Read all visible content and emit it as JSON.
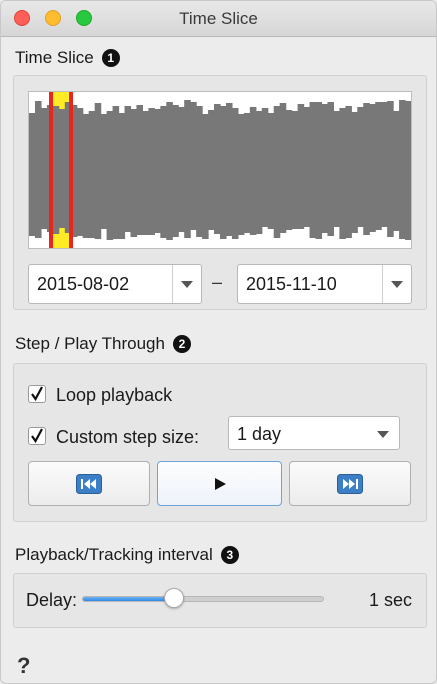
{
  "window": {
    "title": "Time Slice"
  },
  "time_slice": {
    "heading": "Time Slice",
    "badge": "1",
    "start_date": "2015-08-02",
    "separator": "–",
    "end_date": "2015-11-10"
  },
  "step": {
    "heading": "Step / Play Through",
    "badge": "2",
    "loop_label": "Loop playback",
    "loop_checked": true,
    "custom_label": "Custom step size:",
    "custom_checked": true,
    "step_size": "1 day",
    "buttons": [
      "skip-back-icon",
      "play-icon",
      "skip-forward-icon"
    ]
  },
  "playback": {
    "heading": "Playback/Tracking interval",
    "badge": "3",
    "delay_label": "Delay:",
    "delay_value": "1 sec",
    "slider_fraction": 0.38
  },
  "footer": {
    "help_glyph": "?"
  },
  "colors": {
    "accent": "#2f86e6",
    "selection": "#e8261d",
    "selection_fill": "#ffe600",
    "data": "#787878"
  }
}
